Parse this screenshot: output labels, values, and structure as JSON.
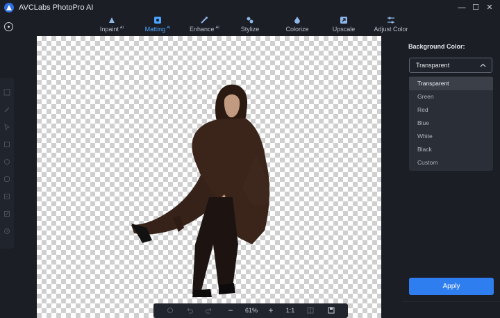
{
  "app": {
    "title": "AVCLabs PhotoPro AI"
  },
  "window": {
    "minimize": "—",
    "maximize": "☐",
    "close": "✕"
  },
  "toolbar": {
    "items": [
      {
        "label": "Inpaint",
        "badge": "AI",
        "icon": "inpaint-icon"
      },
      {
        "label": "Matting",
        "badge": "AI",
        "icon": "matting-icon",
        "active": true
      },
      {
        "label": "Enhance",
        "badge": "AI",
        "icon": "enhance-icon"
      },
      {
        "label": "Stylize",
        "badge": "",
        "icon": "stylize-icon"
      },
      {
        "label": "Colorize",
        "badge": "",
        "icon": "colorize-icon"
      },
      {
        "label": "Upscale",
        "badge": "",
        "icon": "upscale-icon"
      },
      {
        "label": "Adjust Color",
        "badge": "",
        "icon": "adjust-color-icon"
      }
    ]
  },
  "bottombar": {
    "zoom_out": "−",
    "zoom_value": "61%",
    "zoom_in": "+",
    "ratio": "1:1"
  },
  "panel": {
    "label": "Background Color:",
    "selected": "Transparent",
    "options": [
      "Transparent",
      "Green",
      "Red",
      "Blue",
      "White",
      "Black",
      "Custom"
    ],
    "apply_label": "Apply"
  },
  "colors": {
    "accent": "#2f7ef0",
    "active_tab": "#4aa4ff",
    "background": "#1b1e25"
  }
}
